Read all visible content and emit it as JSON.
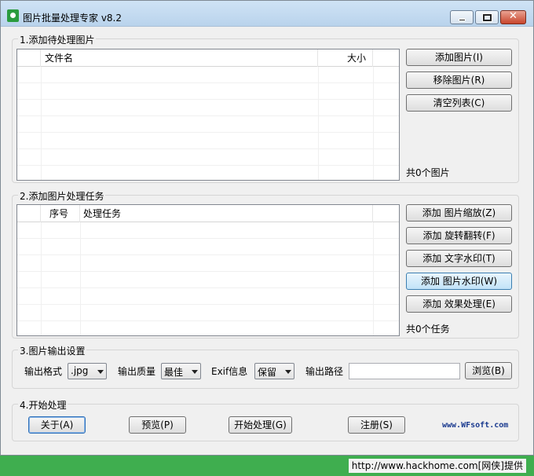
{
  "window": {
    "title": "图片批量处理专家 v8.2"
  },
  "section1": {
    "label": "1.添加待处理图片",
    "columns": [
      "文件名",
      "大小"
    ],
    "buttons": [
      "添加图片(I)",
      "移除图片(R)",
      "清空列表(C)"
    ],
    "count": "共0个图片"
  },
  "section2": {
    "label": "2.添加图片处理任务",
    "columns": [
      "序号",
      "处理任务"
    ],
    "buttons": [
      "添加 图片缩放(Z)",
      "添加 旋转翻转(F)",
      "添加 文字水印(T)",
      "添加 图片水印(W)",
      "添加 效果处理(E)"
    ],
    "count": "共0个任务"
  },
  "section3": {
    "label": "3.图片输出设置",
    "format_label": "输出格式",
    "format_value": ".jpg",
    "quality_label": "输出质量",
    "quality_value": "最佳",
    "exif_label": "Exif信息",
    "exif_value": "保留",
    "path_label": "输出路径",
    "path_value": "",
    "browse_button": "浏览(B)"
  },
  "section4": {
    "label": "4.开始处理",
    "buttons": [
      "关于(A)",
      "预览(P)",
      "开始处理(G)",
      "注册(S)"
    ],
    "site": "www.WFsoft.com"
  },
  "footer": {
    "text": "http://www.hackhome.com[网侠]提供"
  }
}
